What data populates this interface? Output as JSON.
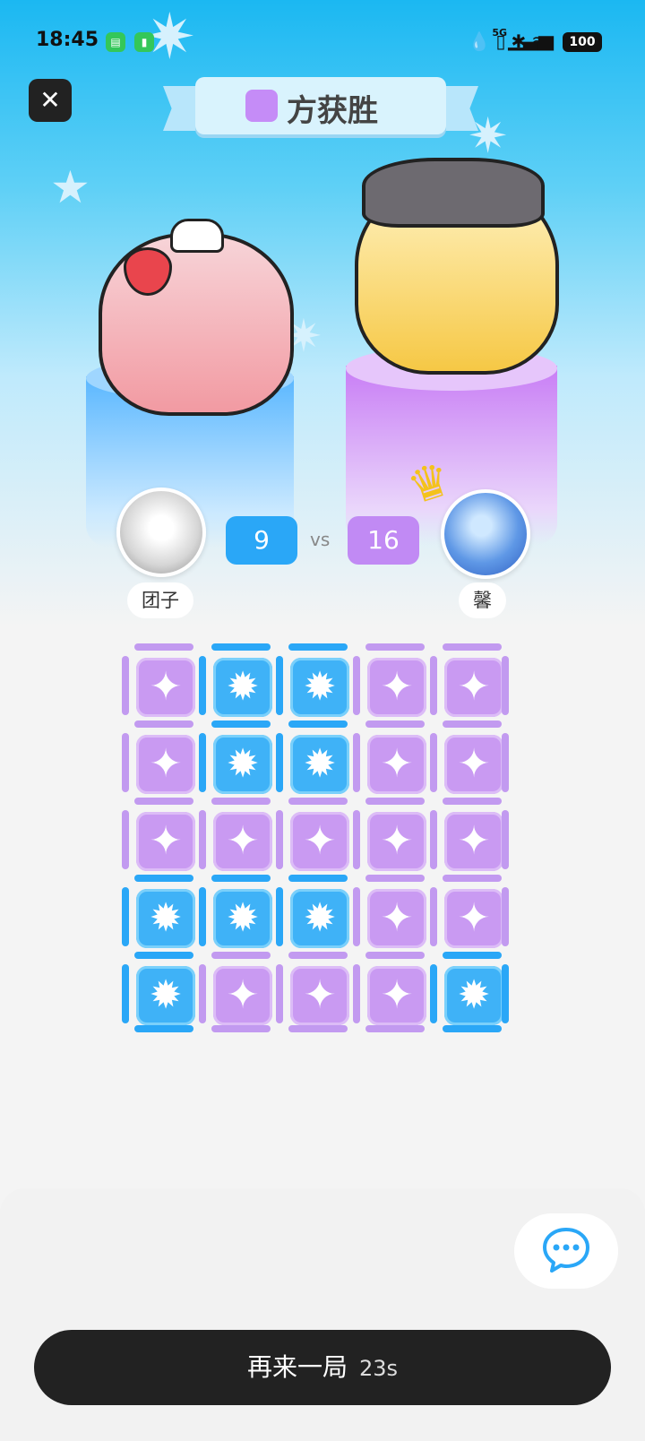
{
  "status_bar": {
    "time": "18:45",
    "battery": "100",
    "signal": "5G"
  },
  "close_button": {
    "icon": "close-icon",
    "glyph": "✕"
  },
  "banner": {
    "title": "方获胜",
    "winner_swatch_color": "#c58cf7"
  },
  "players": {
    "left": {
      "name": "团子",
      "score": "9",
      "color": "#2aa7f7"
    },
    "right": {
      "name": "馨",
      "score": "16",
      "color": "#c18af4",
      "winner_crown": "crown-icon"
    }
  },
  "vs_label": "vs",
  "board": {
    "rows": [
      [
        "purple",
        "blue",
        "blue",
        "purple",
        "purple"
      ],
      [
        "purple",
        "blue",
        "blue",
        "purple",
        "purple"
      ],
      [
        "purple",
        "purple",
        "purple",
        "purple",
        "purple"
      ],
      [
        "blue",
        "blue",
        "blue",
        "purple",
        "purple"
      ],
      [
        "blue",
        "purple",
        "purple",
        "purple",
        "blue"
      ]
    ],
    "blue_glyph": "✹",
    "purple_glyph": "✦"
  },
  "chat_button": {
    "icon": "chat-bubble-icon"
  },
  "replay_button": {
    "label": "再来一局",
    "countdown": "23s"
  }
}
